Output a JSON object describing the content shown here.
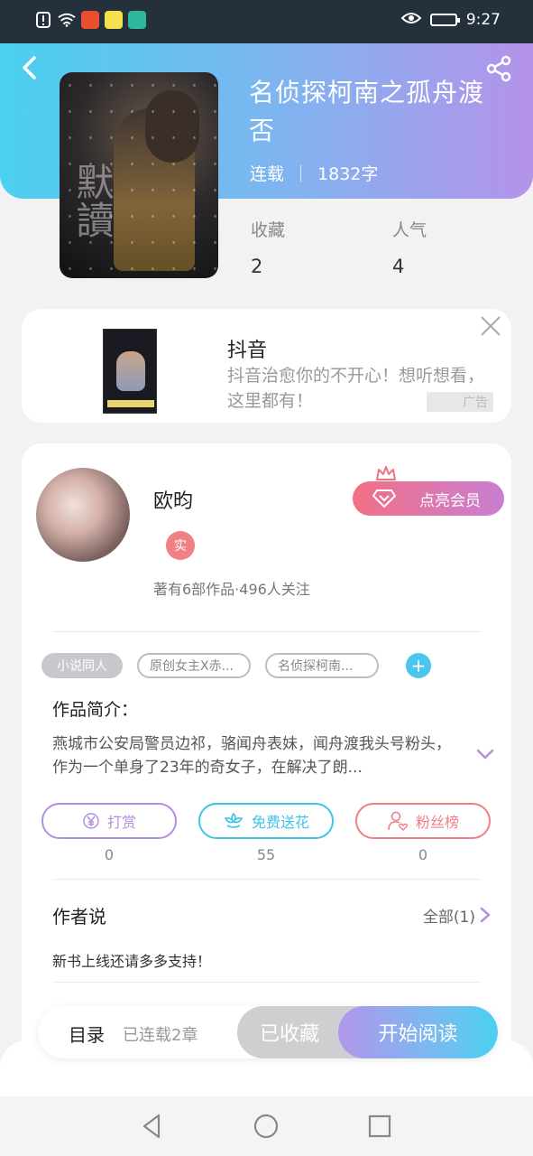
{
  "status_bar": {
    "time": "9:27",
    "left_icons": [
      "alert-icon",
      "wifi-icon",
      "app-icon-1",
      "app-icon-2",
      "app-icon-3"
    ],
    "right_icons": [
      "eye-icon",
      "battery-icon"
    ]
  },
  "book": {
    "title": "名侦探柯南之孤舟渡否",
    "status": "连载",
    "word_count": "1832字",
    "stats": [
      {
        "label": "收藏",
        "value": "2"
      },
      {
        "label": "人气",
        "value": "4"
      }
    ]
  },
  "ad": {
    "title": "抖音",
    "description": "抖音治愈你的不开心！想听想看，这里都有！",
    "tag": "广告"
  },
  "author": {
    "name": "欧昀",
    "badge": "实",
    "works_info": "著有6部作品·496人关注",
    "vip_label": "点亮会员"
  },
  "tags": [
    "小说同人",
    "原创女主X赤...",
    "名侦探柯南..."
  ],
  "intro": {
    "label": "作品简介：",
    "text": "燕城市公安局警员边祁，骆闻舟表妹，闻舟渡我头号粉头，作为一个单身了23年的奇女子，在解决了朗..."
  },
  "actions": [
    {
      "label": "打赏",
      "count": "0",
      "color": "#b58ee0",
      "icon": "yen-icon"
    },
    {
      "label": "免费送花",
      "count": "55",
      "color": "#3fc3e8",
      "icon": "flower-icon"
    },
    {
      "label": "粉丝榜",
      "count": "0",
      "color": "#ee7f86",
      "icon": "fan-icon"
    }
  ],
  "author_says": {
    "title": "作者说",
    "all_label": "全部(1)",
    "text": "新书上线还请多多支持！"
  },
  "bottom_bar": {
    "toc": "目录",
    "toc_sub": "已连载2章",
    "collected": "已收藏",
    "start_read": "开始阅读"
  },
  "colors": {
    "accent_gradient_start": "#4ad0f1",
    "accent_gradient_end": "#b493ea"
  }
}
